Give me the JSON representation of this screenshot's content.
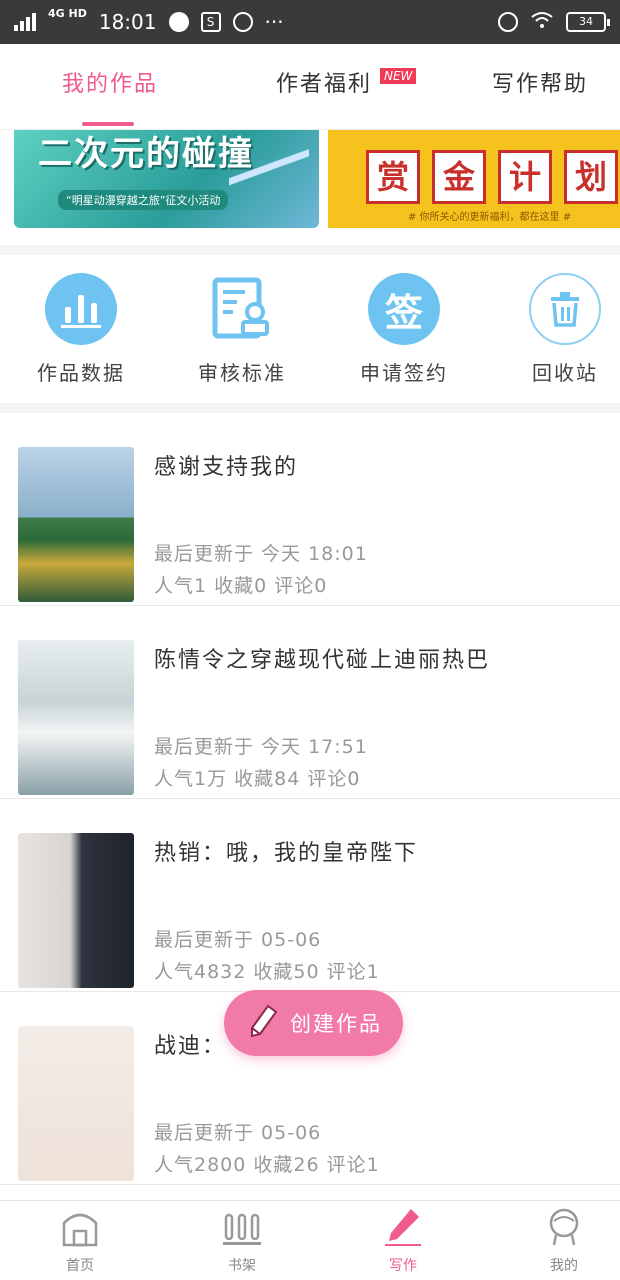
{
  "status_bar": {
    "network": "4G HD",
    "time": "18:01",
    "more": "···",
    "battery": "34"
  },
  "tabs": [
    {
      "label": "我的作品",
      "active": true
    },
    {
      "label": "作者福利",
      "badge": "NEW"
    },
    {
      "label": "写作帮助"
    }
  ],
  "banners": {
    "left_title": "二次元的碰撞",
    "left_sub": "“明星动漫穿越之旅”征文小活动",
    "right_chars": [
      "赏",
      "金",
      "计",
      "划"
    ],
    "right_sub": "# 你所关心的更新福利，都在这里 #"
  },
  "quick_actions": [
    {
      "label": "作品数据",
      "icon": "bar-chart-icon"
    },
    {
      "label": "审核标准",
      "icon": "document-stamp-icon"
    },
    {
      "label": "申请签约",
      "icon": "sign-icon",
      "icon_text": "签"
    },
    {
      "label": "回收站",
      "icon": "trash-icon"
    }
  ],
  "works": [
    {
      "title": "感谢支持我的",
      "update": "最后更新于 今天 18:01",
      "stats": "人气1 收藏0 评论0"
    },
    {
      "title": "陈情令之穿越现代碰上迪丽热巴",
      "update": "最后更新于 今天 17:51",
      "stats": "人气1万 收藏84 评论0"
    },
    {
      "title": "热销：哦，我的皇帝陛下",
      "update": "最后更新于 05-06",
      "stats": "人气4832 收藏50 评论1"
    },
    {
      "title": "战迪：",
      "update": "最后更新于 05-06",
      "stats": "人气2800 收藏26 评论1"
    }
  ],
  "fab": {
    "label": "创建作品"
  },
  "bottom_nav": [
    {
      "label": "首页",
      "icon": "home-icon"
    },
    {
      "label": "书架",
      "icon": "bookshelf-icon"
    },
    {
      "label": "写作",
      "icon": "pen-icon",
      "active": true
    },
    {
      "label": "我的",
      "icon": "profile-icon"
    }
  ],
  "colors": {
    "accent": "#ef5b8f",
    "icon_blue": "#6fc3f0",
    "fab": "#f17aa8"
  }
}
